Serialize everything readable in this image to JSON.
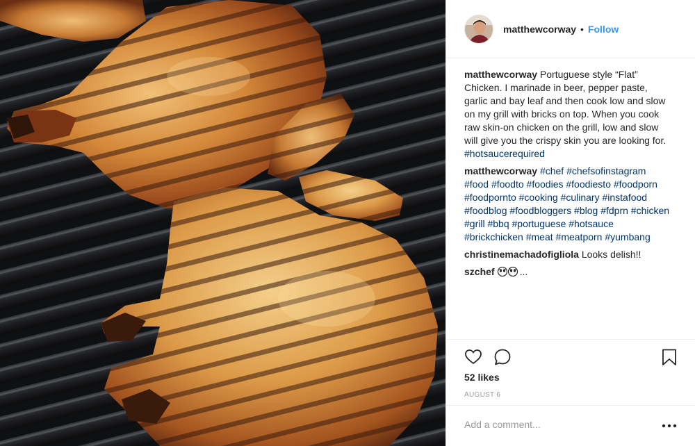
{
  "header": {
    "username": "matthewcorway",
    "separator": "•",
    "follow_label": "Follow"
  },
  "comments": [
    {
      "user": "matthewcorway",
      "text": "Portuguese style “Flat” Chicken. I marinade in beer, pepper paste, garlic and bay leaf and then cook low and slow on my grill with bricks on top. When you cook raw skin-on chicken on the grill, low and slow will give you the crispy skin you are looking for.",
      "hashtags": [
        "#hotsaucerequired"
      ]
    },
    {
      "user": "matthewcorway",
      "text": "",
      "hashtags": [
        "#chef",
        "#chefsofinstagram",
        "#food",
        "#foodto",
        "#foodies",
        "#foodiesto",
        "#foodporn",
        "#foodpornto",
        "#cooking",
        "#culinary",
        "#instafood",
        "#foodblog",
        "#foodbloggers",
        "#blog",
        "#fdprn",
        "#chicken",
        "#grill",
        "#bbq",
        "#portuguese",
        "#hotsauce",
        "#brickchicken",
        "#meat",
        "#meatporn",
        "#yumbang"
      ]
    },
    {
      "user": "christinemachadofigliola",
      "text": "Looks delish!!",
      "hashtags": []
    },
    {
      "user": "szchef",
      "text": "...",
      "hashtags": [],
      "emoji": "see-no-evil-eyes-emoji"
    }
  ],
  "actions": {
    "like_icon": "heart-icon",
    "comment_icon": "comment-bubble-icon",
    "save_icon": "bookmark-icon"
  },
  "likes_text": "52 likes",
  "date_text": "AUGUST 6",
  "add_comment": {
    "placeholder": "Add a comment...",
    "more_icon": "ellipsis-icon"
  },
  "colors": {
    "link_blue": "#3897f0",
    "hashtag": "#003569",
    "muted": "#999999",
    "text": "#262626"
  }
}
